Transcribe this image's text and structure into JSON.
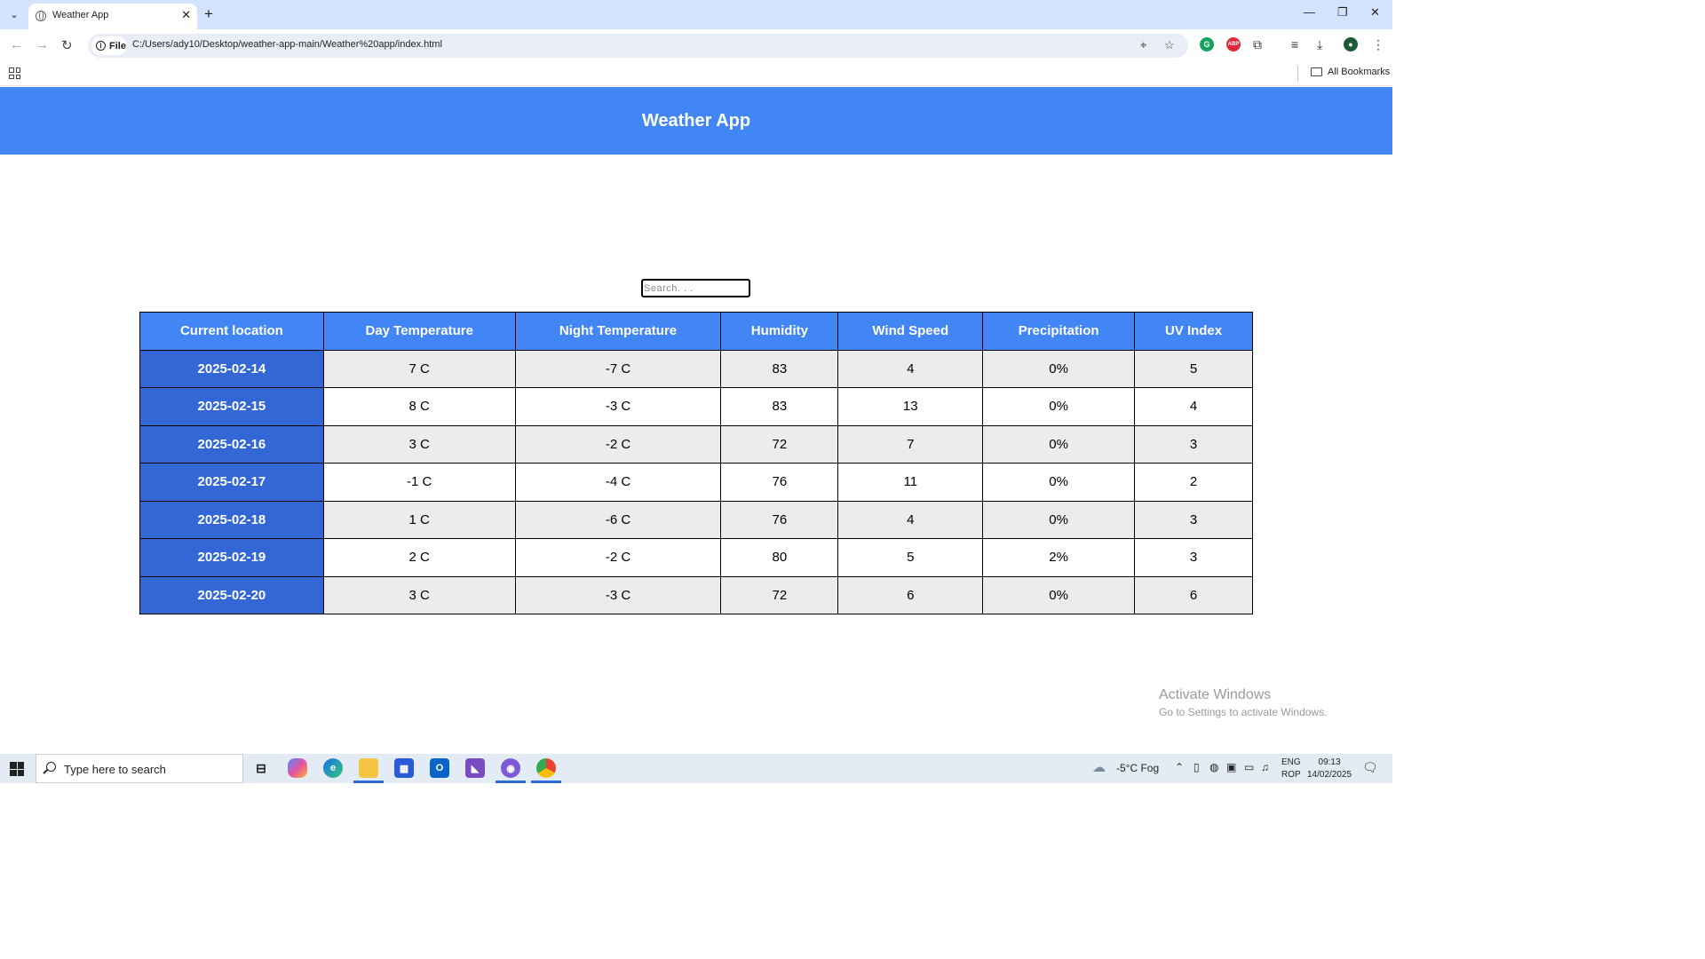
{
  "browser": {
    "tab_title": "Weather App",
    "close_glyph": "✕",
    "new_tab_glyph": "+",
    "chip_label": "File",
    "url": "C:/Users/ady10/Desktop/weather-app-main/Weather%20app/index.html",
    "all_bookmarks": "All Bookmarks"
  },
  "page": {
    "title": "Weather App",
    "search_placeholder": "Search. . ."
  },
  "table": {
    "headers": [
      "Current location",
      "Day Temperature",
      "Night Temperature",
      "Humidity",
      "Wind Speed",
      "Precipitation",
      "UV Index"
    ],
    "rows": [
      [
        "2025-02-14",
        "7 C",
        "-7 C",
        "83",
        "4",
        "0%",
        "5"
      ],
      [
        "2025-02-15",
        "8 C",
        "-3 C",
        "83",
        "13",
        "0%",
        "4"
      ],
      [
        "2025-02-16",
        "3 C",
        "-2 C",
        "72",
        "7",
        "0%",
        "3"
      ],
      [
        "2025-02-17",
        "-1 C",
        "-4 C",
        "76",
        "11",
        "0%",
        "2"
      ],
      [
        "2025-02-18",
        "1 C",
        "-6 C",
        "76",
        "4",
        "0%",
        "3"
      ],
      [
        "2025-02-19",
        "2 C",
        "-2 C",
        "80",
        "5",
        "2%",
        "3"
      ],
      [
        "2025-02-20",
        "3 C",
        "-3 C",
        "72",
        "6",
        "0%",
        "6"
      ]
    ]
  },
  "watermark": {
    "line1": "Activate Windows",
    "line2": "Go to Settings to activate Windows."
  },
  "taskbar": {
    "search_text": "Type here to search",
    "weather": "-5°C  Fog",
    "lang1": "ENG",
    "lang2": "ROP",
    "time": "09:13",
    "date": "14/02/2025"
  },
  "colors": {
    "header": "#4285f4",
    "date_cell": "#3367d6"
  }
}
